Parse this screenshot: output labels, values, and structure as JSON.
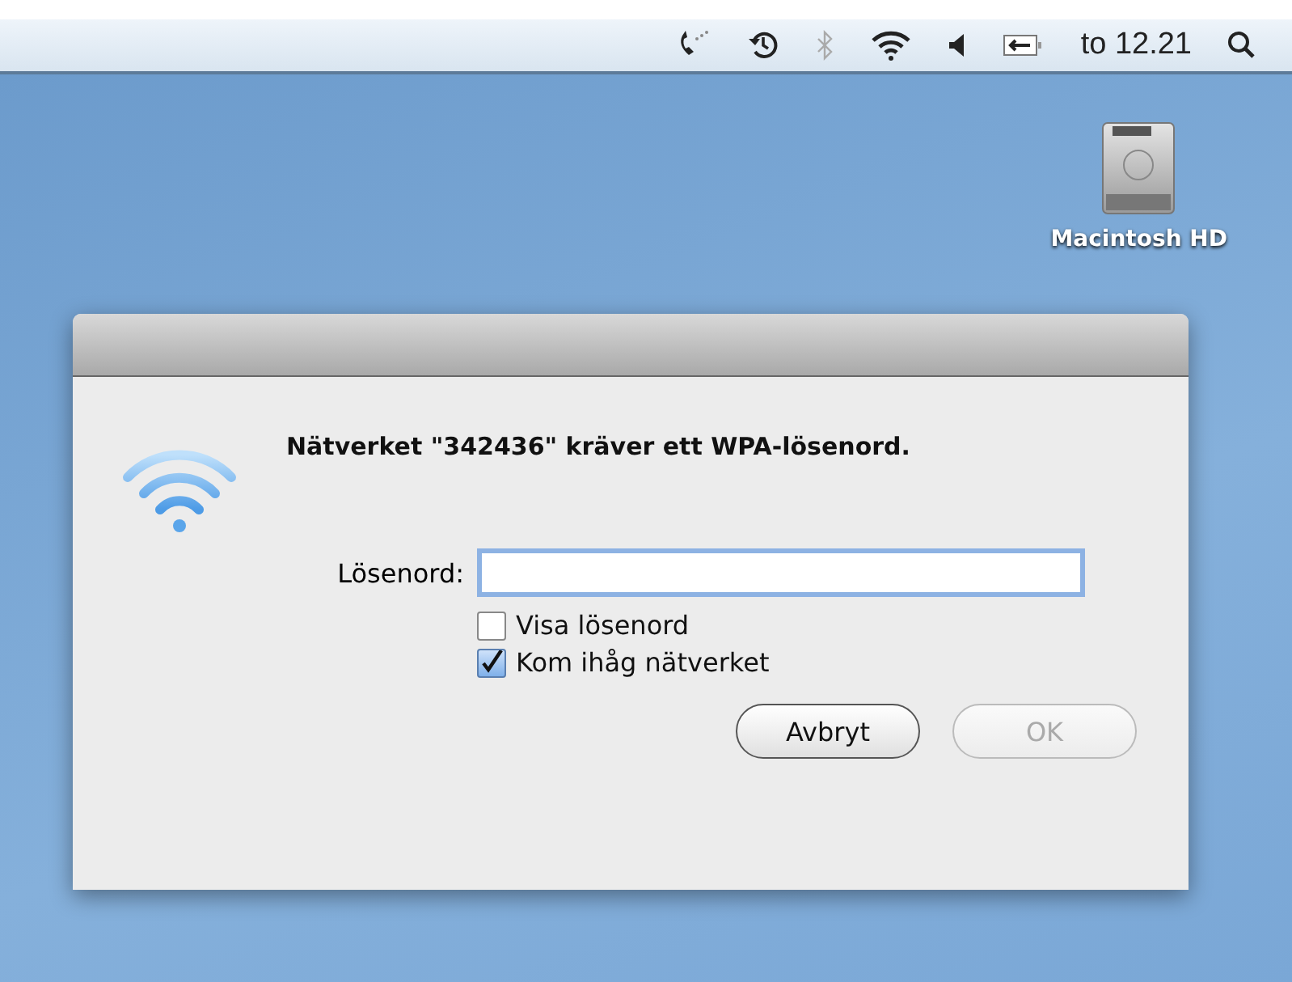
{
  "menu_bar": {
    "clock": "to 12.21"
  },
  "desktop": {
    "icons": [
      {
        "label": "Macintosh HD"
      }
    ]
  },
  "dialog": {
    "message": "Nätverket \"342436\" kräver ett WPA-lösenord.",
    "password": {
      "label": "Lösenord:",
      "focused": true
    },
    "options": [
      {
        "label": "Visa lösenord",
        "checked": false
      },
      {
        "label": "Kom ihåg nätverket",
        "checked": true
      }
    ],
    "buttons": [
      {
        "label": "Avbryt",
        "disabled": false
      },
      {
        "label": "OK",
        "disabled": true
      }
    ]
  }
}
